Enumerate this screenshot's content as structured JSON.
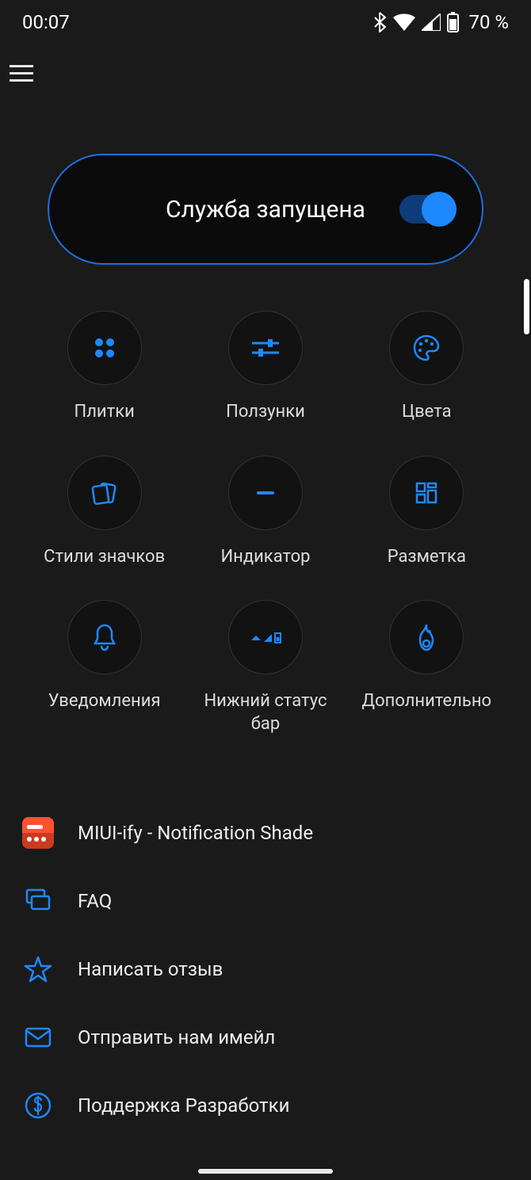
{
  "status": {
    "time": "00:07",
    "battery": "70 %"
  },
  "accent": "#1e88ff",
  "card": {
    "label": "Служба запущена"
  },
  "grid": [
    {
      "icon": "tiles-icon",
      "label": "Плитки"
    },
    {
      "icon": "sliders-icon",
      "label": "Ползунки"
    },
    {
      "icon": "palette-icon",
      "label": "Цвета"
    },
    {
      "icon": "iconstyle-icon",
      "label": "Стили значков"
    },
    {
      "icon": "indicator-icon",
      "label": "Индикатор"
    },
    {
      "icon": "layout-icon",
      "label": "Разметка"
    },
    {
      "icon": "bell-icon",
      "label": "Уведомления"
    },
    {
      "icon": "statusbar-icon",
      "label": "Нижний статус бар"
    },
    {
      "icon": "fire-icon",
      "label": "Дополнительно"
    }
  ],
  "list": [
    {
      "icon": "app-logo-icon",
      "label": "MIUI-ify - Notification Shade"
    },
    {
      "icon": "faq-icon",
      "label": "FAQ"
    },
    {
      "icon": "star-icon",
      "label": "Написать отзыв"
    },
    {
      "icon": "mail-icon",
      "label": "Отправить нам имейл"
    },
    {
      "icon": "dollar-icon",
      "label": "Поддержка Разработки"
    }
  ]
}
